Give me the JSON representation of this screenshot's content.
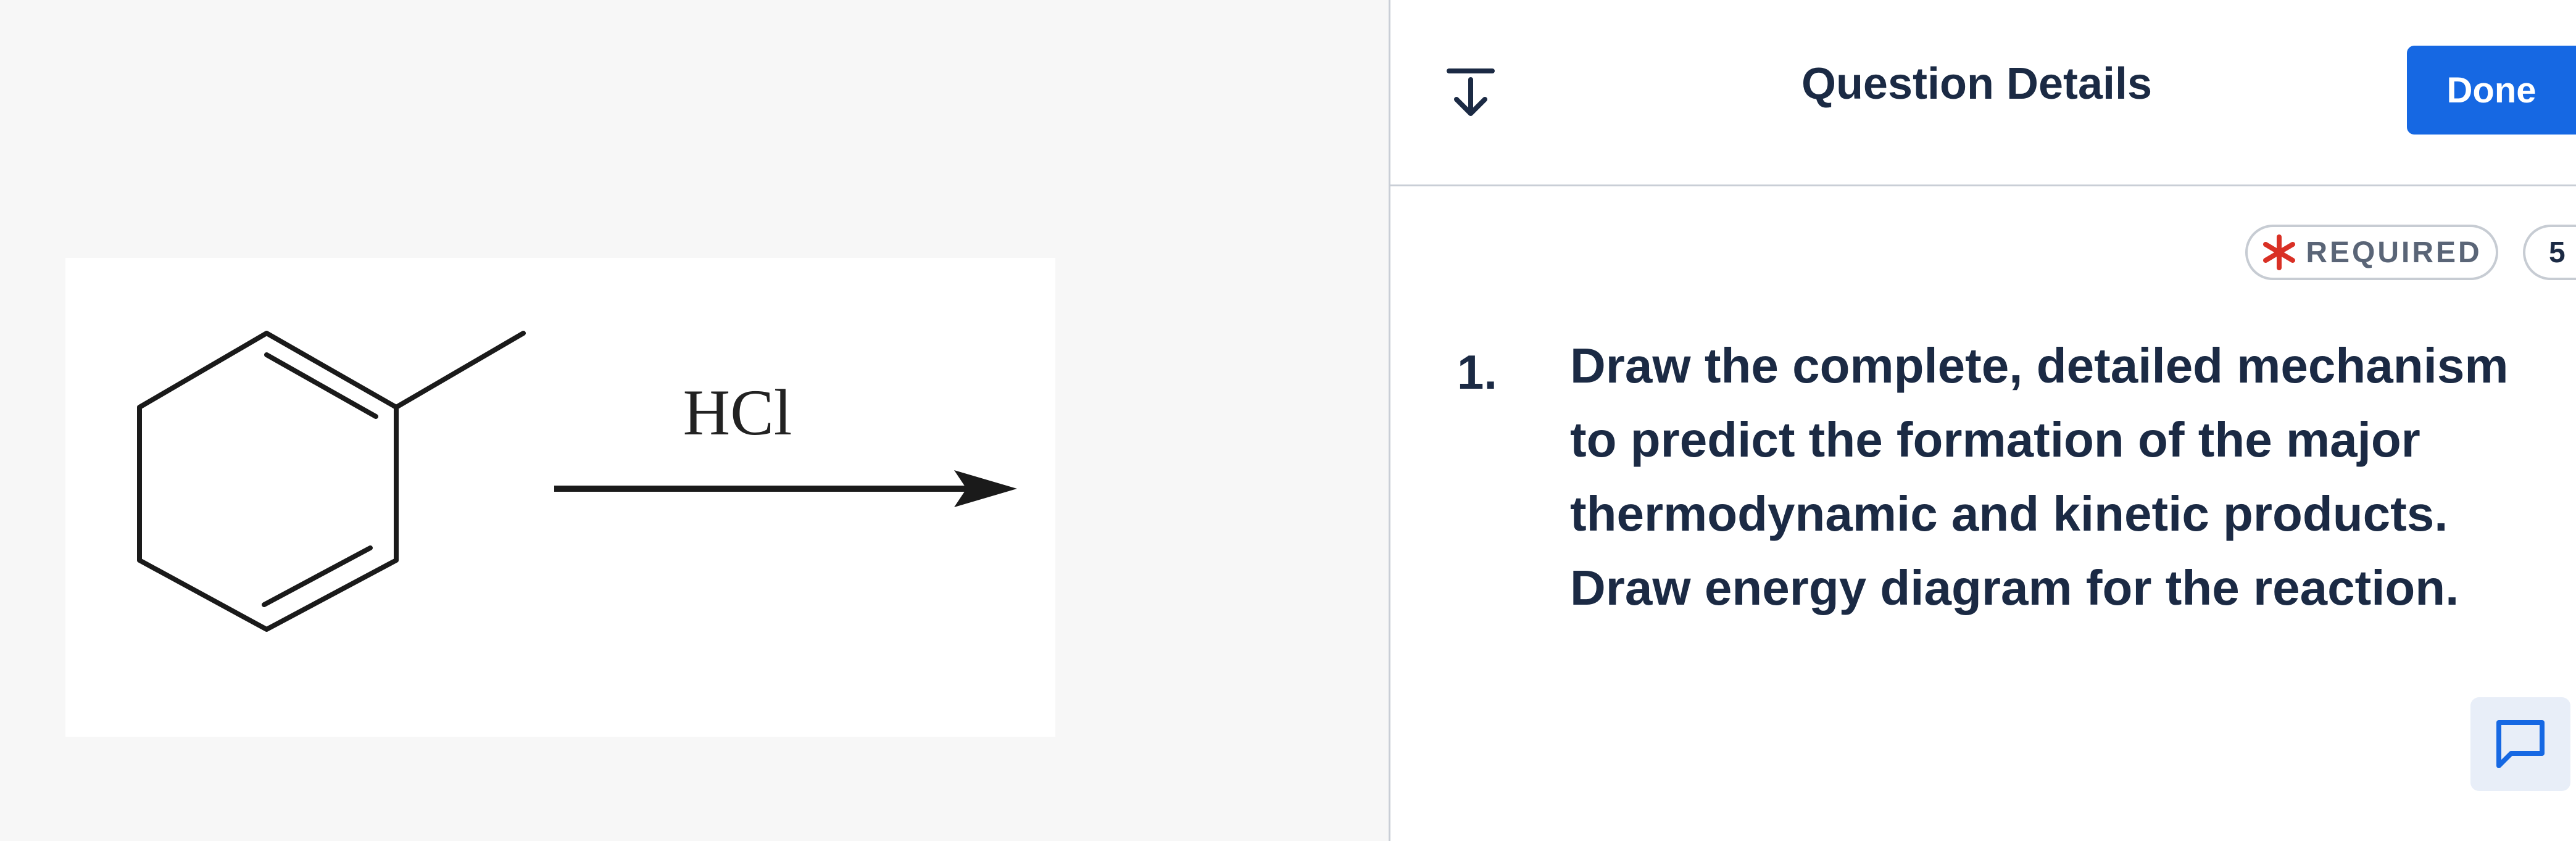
{
  "figure": {
    "reagent": "HCl"
  },
  "header": {
    "title": "Question Details",
    "done_label": "Done"
  },
  "badges": {
    "required_label": "REQUIRED",
    "points": "5"
  },
  "question": {
    "number": "1.",
    "lines": [
      "Draw the complete, detailed mechanism",
      "to predict the formation of the major",
      "thermodynamic and kinetic products.",
      "Draw energy diagram for the reaction."
    ]
  },
  "colors": {
    "accent": "#1668e3",
    "required_star": "#d93025",
    "text": "#1b2a44",
    "divider": "#c9ced6"
  },
  "icons": {
    "collapse": "collapse-down-icon",
    "required": "asterisk-icon",
    "comment": "comment-icon"
  }
}
